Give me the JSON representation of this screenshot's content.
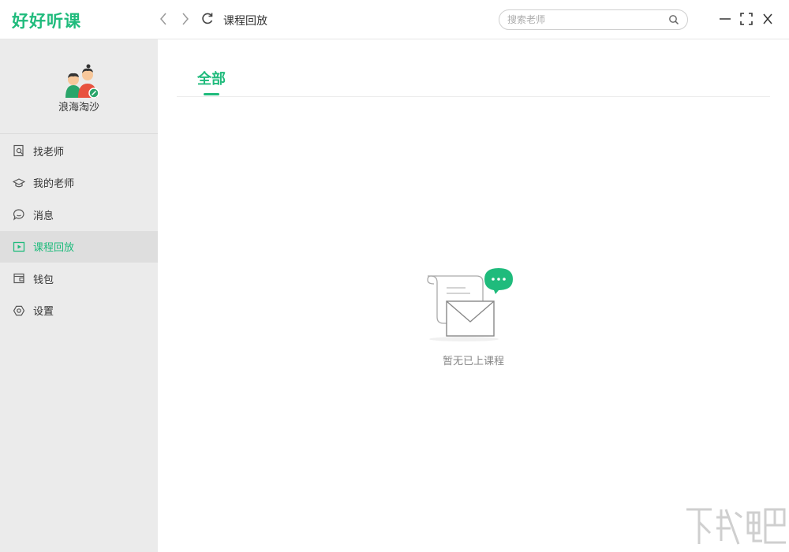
{
  "app": {
    "logo": "好好听课"
  },
  "header": {
    "page_title": "课程回放",
    "search_placeholder": "搜索老师"
  },
  "profile": {
    "username": "浪海淘沙"
  },
  "sidebar": {
    "items": [
      {
        "label": "找老师",
        "icon": "find-teacher-icon",
        "active": false
      },
      {
        "label": "我的老师",
        "icon": "graduation-cap-icon",
        "active": false
      },
      {
        "label": "消息",
        "icon": "chat-bubble-icon",
        "active": false
      },
      {
        "label": "课程回放",
        "icon": "play-icon",
        "active": true
      },
      {
        "label": "钱包",
        "icon": "wallet-icon",
        "active": false
      },
      {
        "label": "设置",
        "icon": "settings-icon",
        "active": false
      }
    ]
  },
  "main": {
    "tabs": [
      {
        "label": "全部",
        "active": true
      }
    ],
    "empty_text": "暂无已上课程"
  },
  "colors": {
    "accent": "#1fbb7c",
    "sidebar_bg": "#ebebeb",
    "active_item_bg": "#dedede"
  }
}
